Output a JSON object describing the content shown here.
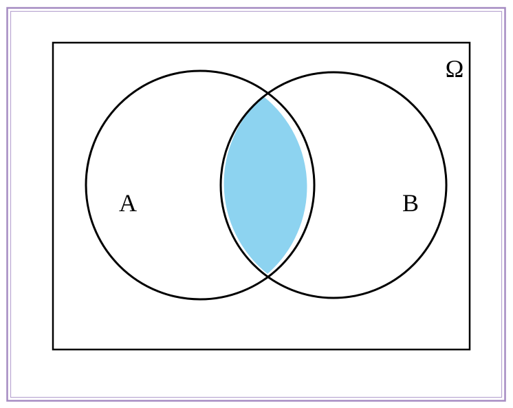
{
  "diagram": {
    "type": "venn",
    "universe_label": "Ω",
    "sets": [
      {
        "label": "A"
      },
      {
        "label": "B"
      }
    ],
    "highlighted_region": "A ∩ B",
    "colors": {
      "intersection_fill": "#8dd3f0",
      "stroke": "#000000",
      "frame_outer": "#a58cc2",
      "frame_inner": "#b9a6d2",
      "background": "#ffffff"
    }
  }
}
